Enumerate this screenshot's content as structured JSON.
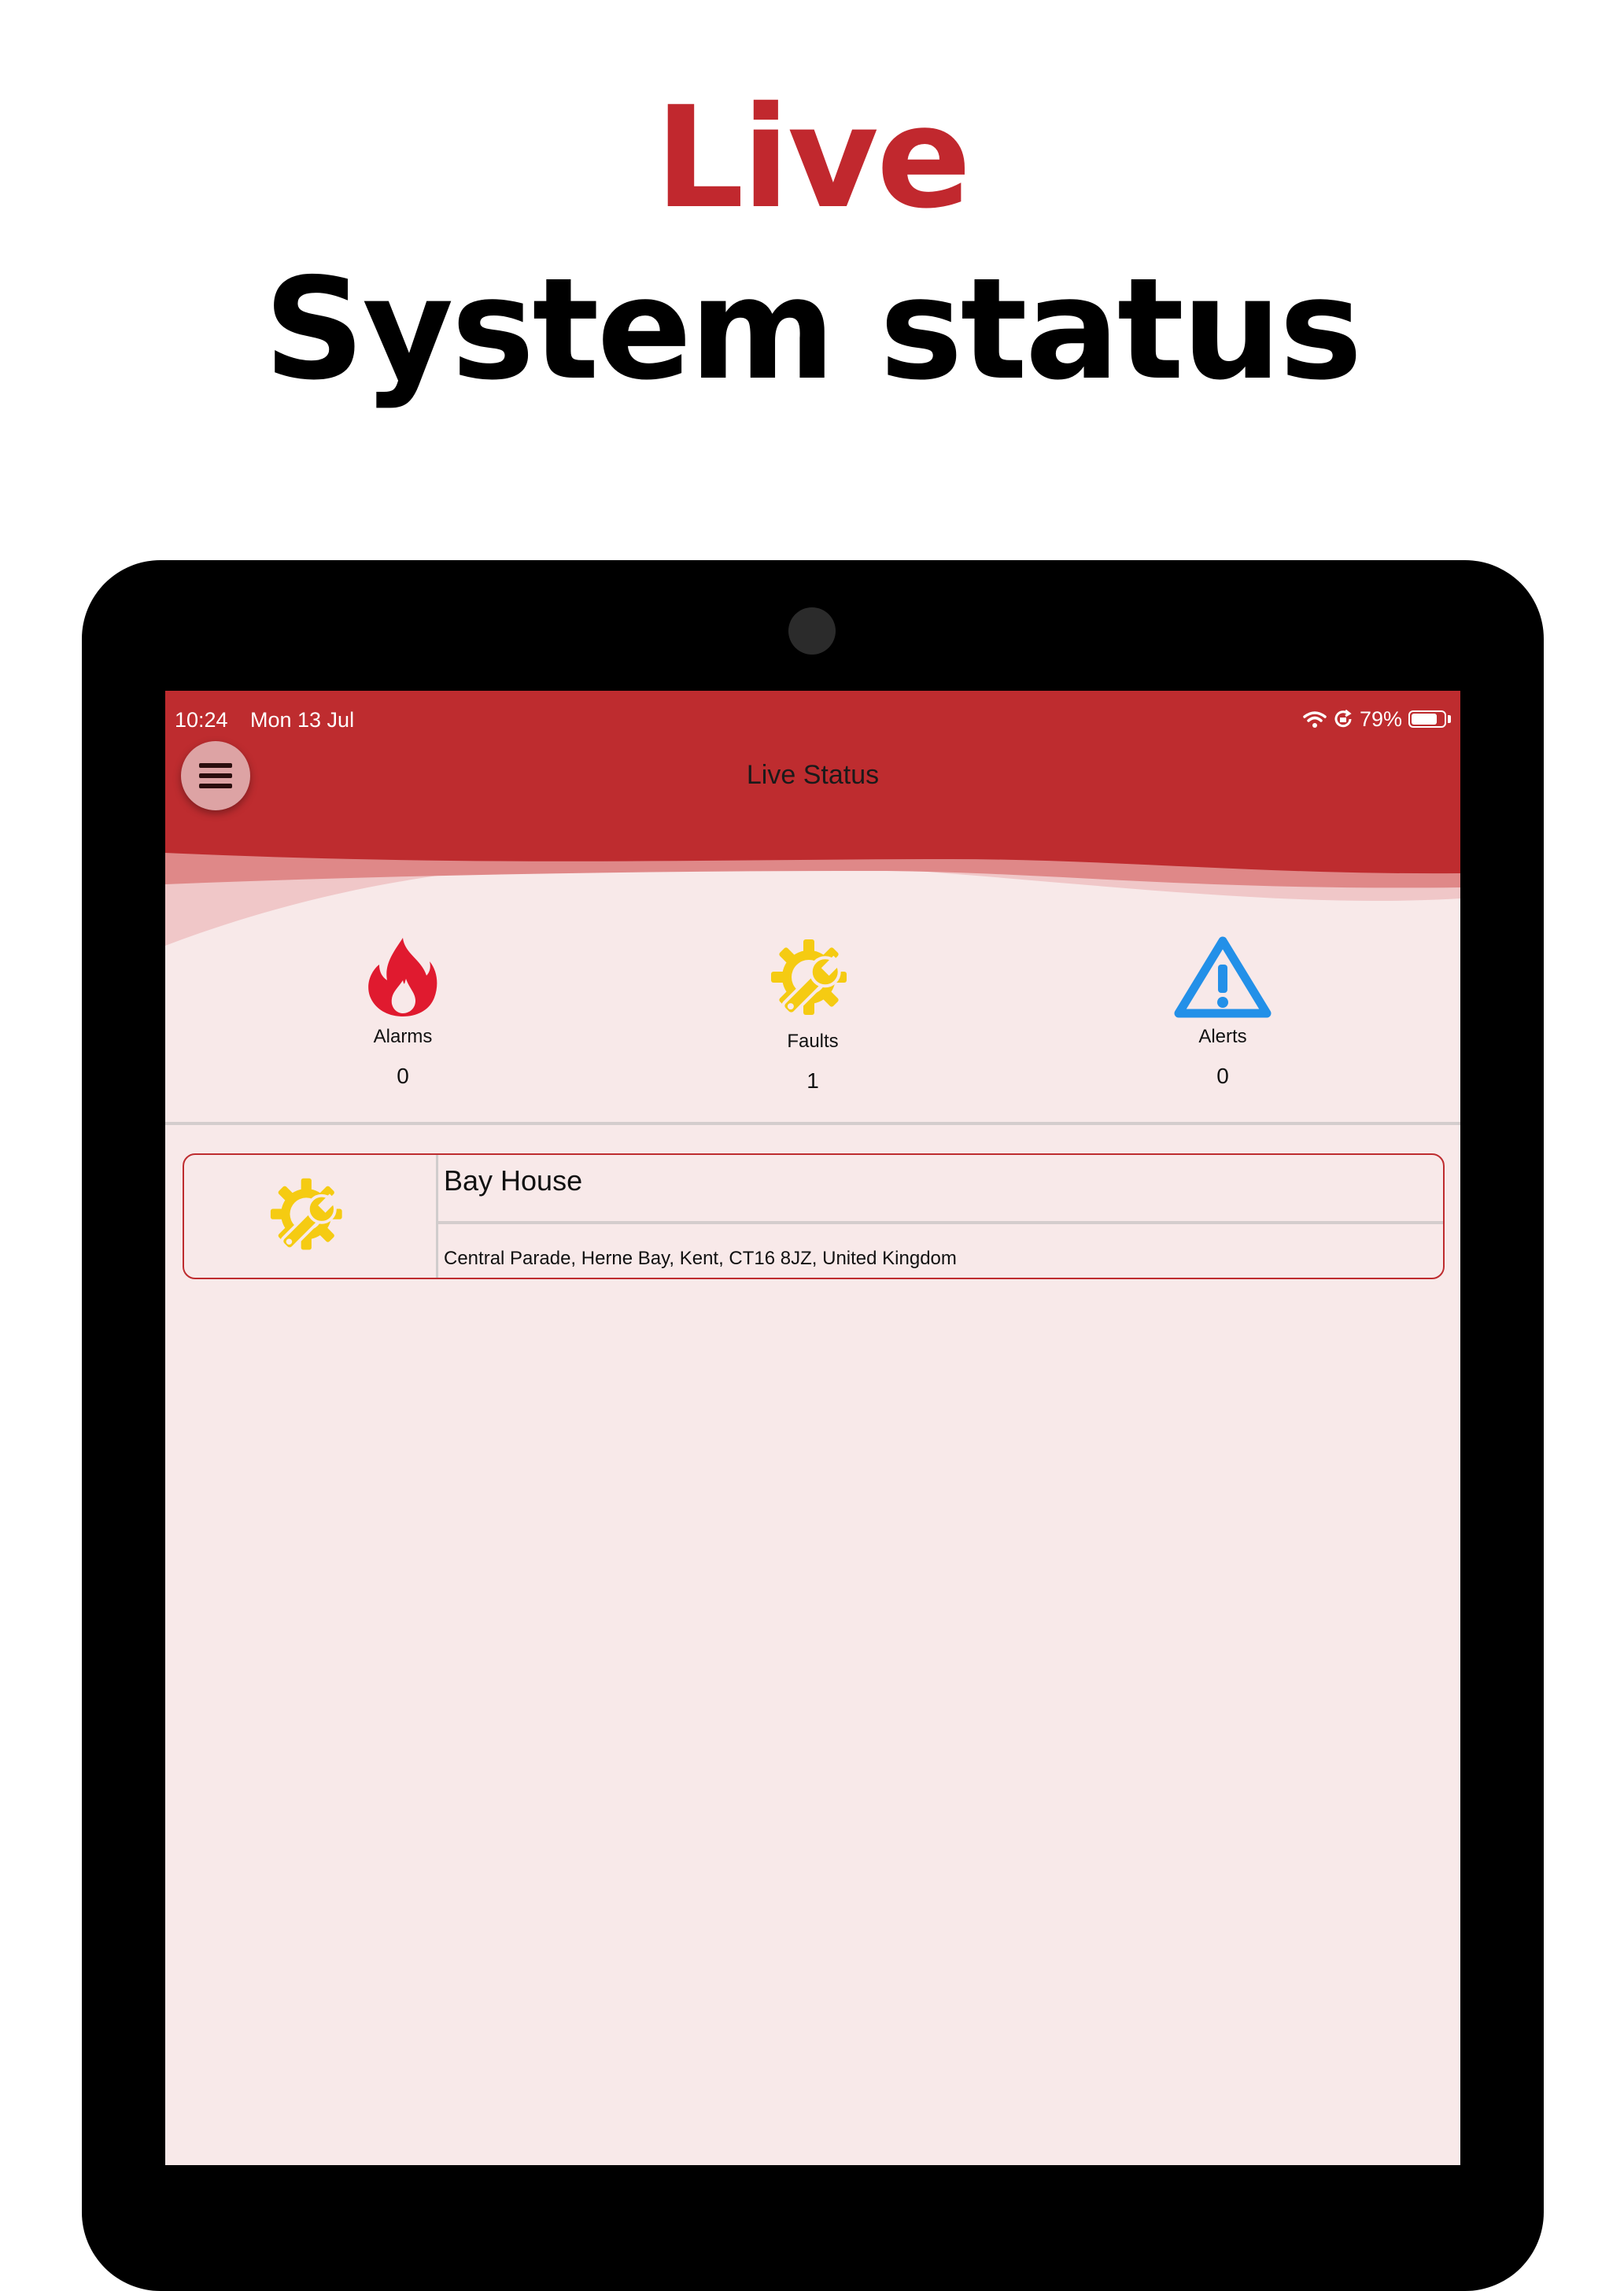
{
  "headline": {
    "line1": "Live",
    "line2": "System status"
  },
  "status_bar": {
    "time": "10:24",
    "date": "Mon 13 Jul",
    "battery": "79%",
    "battery_level": 0.79
  },
  "app_bar": {
    "title": "Live Status",
    "menu_icon": "hamburger-menu-icon"
  },
  "colors": {
    "brand_red": "#be2c2f",
    "alarm_red": "#e01a2f",
    "fault_yellow": "#f5cb12",
    "alert_blue": "#2390e8",
    "background": "#f8e9e9"
  },
  "counters": [
    {
      "label": "Alarms",
      "value": "0",
      "icon": "flame-icon"
    },
    {
      "label": "Faults",
      "value": "1",
      "icon": "gear-wrench-icon"
    },
    {
      "label": "Alerts",
      "value": "0",
      "icon": "warning-triangle-icon"
    }
  ],
  "sites": [
    {
      "name": "Bay House",
      "address": "Central Parade, Herne Bay, Kent, CT16 8JZ, United Kingdom",
      "icon": "gear-wrench-icon"
    }
  ]
}
